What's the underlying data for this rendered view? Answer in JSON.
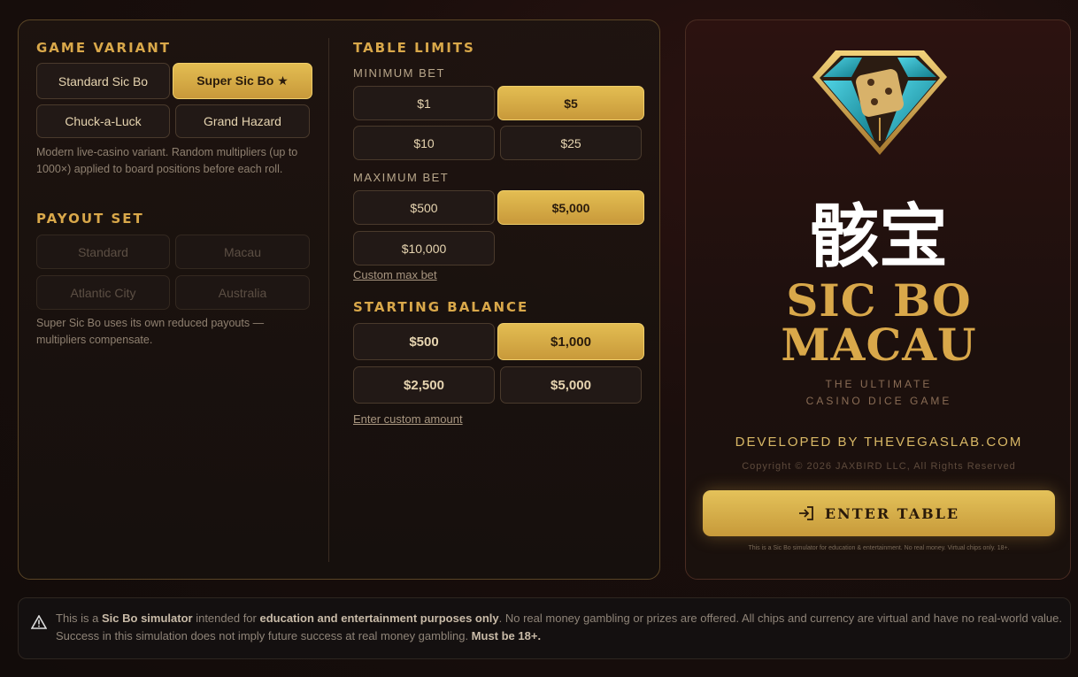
{
  "left": {
    "game_variant": {
      "title": "GAME VARIANT",
      "options": [
        "Standard Sic Bo",
        "Super Sic Bo ★",
        "Chuck-a-Luck",
        "Grand Hazard"
      ],
      "selected": "Super Sic Bo ★",
      "description": "Modern live-casino variant. Random multipliers (up to 1000×) applied to board positions before each roll."
    },
    "payout_set": {
      "title": "PAYOUT SET",
      "options": [
        "Standard",
        "Macau",
        "Atlantic City",
        "Australia"
      ],
      "disabled": true,
      "note": "Super Sic Bo uses its own reduced payouts — multipliers compensate."
    },
    "table_limits": {
      "title": "TABLE LIMITS",
      "min_label": "MINIMUM BET",
      "min_options": [
        "$1",
        "$5",
        "$10",
        "$25"
      ],
      "min_selected": "$5",
      "max_label": "MAXIMUM BET",
      "max_options": [
        "$500",
        "$5,000",
        "$10,000"
      ],
      "max_selected": "$5,000",
      "custom_max": "Custom max bet"
    },
    "starting_balance": {
      "title": "STARTING BALANCE",
      "options": [
        "$500",
        "$1,000",
        "$2,500",
        "$5,000"
      ],
      "selected": "$1,000",
      "custom": "Enter custom amount"
    }
  },
  "right": {
    "cn_title": "骸宝",
    "brand_line1": "SIC BO",
    "brand_line2": "MACAU",
    "tagline_line1": "THE ULTIMATE",
    "tagline_line2": "CASINO DICE GAME",
    "developer": "DEVELOPED BY THEVEGASLAB.COM",
    "copyright": "Copyright © 2026 JAXBIRD LLC, All Rights Reserved",
    "enter_label": "ENTER TABLE",
    "fine_print": "This is a Sic Bo simulator for education & entertainment. No real money. Virtual chips only. 18+."
  },
  "footer": {
    "p1": "This is a ",
    "b1": "Sic Bo simulator",
    "p2": " intended for ",
    "b2": "education and entertainment purposes only",
    "p3": ". No real money gambling or prizes are offered. All chips and currency are virtual and have no real-world value. Success in this simulation does not imply future success at real money gambling. ",
    "b3": "Must be 18+."
  },
  "colors": {
    "gold": "#d9a84a",
    "selected_bg": "#e3bd52",
    "panel_border": "#5a4526"
  },
  "icons": [
    "gem-dice-logo",
    "enter-icon",
    "warning-icon"
  ]
}
